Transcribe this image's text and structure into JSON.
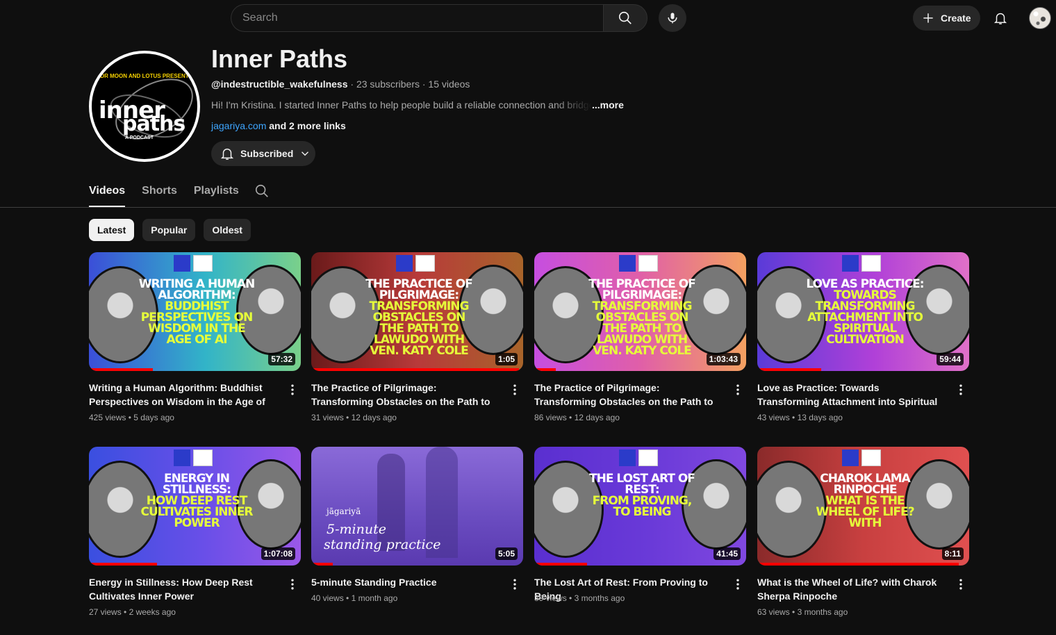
{
  "header": {
    "search_placeholder": "Search",
    "create_label": "Create"
  },
  "channel": {
    "avatar": {
      "tagline": "DR MOON AND LOTUS PRESENT",
      "logo_line1": "inner",
      "logo_line2": "paths",
      "sub": "A PODCAST"
    },
    "title": "Inner Paths",
    "handle": "@indestructible_wakefulness",
    "stats": " · 23 subscribers · 15 videos",
    "description": "Hi! I'm Kristina. I started Inner Paths to help people build a reliable connection and bridge",
    "more_label": "...more",
    "link": "jagariya.com",
    "more_links": " and 2 more links",
    "subscribed_label": "Subscribed"
  },
  "tabs": [
    "Videos",
    "Shorts",
    "Playlists"
  ],
  "chips": [
    "Latest",
    "Popular",
    "Oldest"
  ],
  "videos": [
    {
      "title": "Writing a Human Algorithm: Buddhist Perspectives on Wisdom in the Age of AI",
      "views": "425 views",
      "age": "5 days ago",
      "duration": "57:32",
      "progress": 0.3,
      "thumb_white": "WRITING A HUMAN ALGORITHM:",
      "thumb_yellow": "BUDDHIST PERSPECTIVES ON WISDOM IN THE AGE OF AI",
      "thumb_bg": "linear-gradient(90deg,#3b4fd8,#32b4c8 55%,#7ad08a)"
    },
    {
      "title": "The Practice of Pilgrimage: Transforming Obstacles on the Path to Lawudo with Ven. Katy Cole",
      "views": "31 views",
      "age": "12 days ago",
      "duration": "1:05",
      "progress": 0.98,
      "thumb_white": "THE PRACTICE OF PILGRIMAGE:",
      "thumb_yellow": "TRANSFORMING OBSTACLES ON THE PATH TO LAWUDO WITH VEN. KATY COLE",
      "thumb_bg": "linear-gradient(90deg,#6a1a1a,#b83a3a 50%,#a8642a)"
    },
    {
      "title": "The Practice of Pilgrimage: Transforming Obstacles on the Path to Lawudo with Ven. Katy Cole",
      "views": "86 views",
      "age": "12 days ago",
      "duration": "1:03:43",
      "progress": 0.1,
      "thumb_white": "THE PRACTICE OF PILGRIMAGE:",
      "thumb_yellow": "TRANSFORMING OBSTACLES ON THE PATH TO LAWUDO WITH VEN. KATY COLE",
      "thumb_bg": "linear-gradient(90deg,#c64ee0,#e05fa8 50%,#f3a060)"
    },
    {
      "title": "Love as Practice: Towards Transforming Attachment into Spiritual Cultivation",
      "views": "43 views",
      "age": "13 days ago",
      "duration": "59:44",
      "progress": 0.3,
      "thumb_white": "LOVE AS PRACTICE:",
      "thumb_yellow": "TOWARDS TRANSFORMING ATTACHMENT INTO SPIRITUAL CULTIVATION",
      "thumb_bg": "linear-gradient(90deg,#5a3bd8,#b040d8 55%,#e070c8)"
    },
    {
      "title": "Energy in Stillness: How Deep Rest Cultivates Inner Power",
      "views": "27 views",
      "age": "2 weeks ago",
      "duration": "1:07:08",
      "progress": 0.32,
      "thumb_white": "ENERGY IN STILLNESS:",
      "thumb_yellow": "HOW DEEP REST CULTIVATES INNER POWER",
      "thumb_bg": "linear-gradient(90deg,#3a4fe0,#6a4fe8 55%,#9a58e8)"
    },
    {
      "title": "5-minute Standing Practice",
      "views": "40 views",
      "age": "1 month ago",
      "duration": "5:05",
      "progress": 0.1,
      "thumb_white": "",
      "thumb_yellow": "",
      "thumb_bg": "linear-gradient(180deg,#8a6ad8,#6a4cc0 60%,#5a3ab0)"
    },
    {
      "title": "The Lost Art of Rest: From Proving to Being",
      "views": "39 views",
      "age": "3 months ago",
      "duration": "41:45",
      "progress": 0.25,
      "thumb_white": "THE LOST ART OF REST:",
      "thumb_yellow": "FROM PROVING, TO BEING",
      "thumb_bg": "linear-gradient(90deg,#5a2fd0,#6a3ad8 55%,#8048e0)"
    },
    {
      "title": "What is the Wheel of Life? with Charok Sherpa Rinpoche",
      "views": "63 views",
      "age": "3 months ago",
      "duration": "8:11",
      "progress": 0.95,
      "thumb_white": "CHAROK LAMA RINPOCHE",
      "thumb_yellow": "WHAT IS THE WHEEL OF LIFE? WITH",
      "thumb_bg": "linear-gradient(90deg,#8a2a2a,#c84040 50%,#e05050)"
    }
  ],
  "thumb_special": {
    "standing_brand": "jāgariyā",
    "standing_line1": "5-minute",
    "standing_line2": "standing practice"
  }
}
